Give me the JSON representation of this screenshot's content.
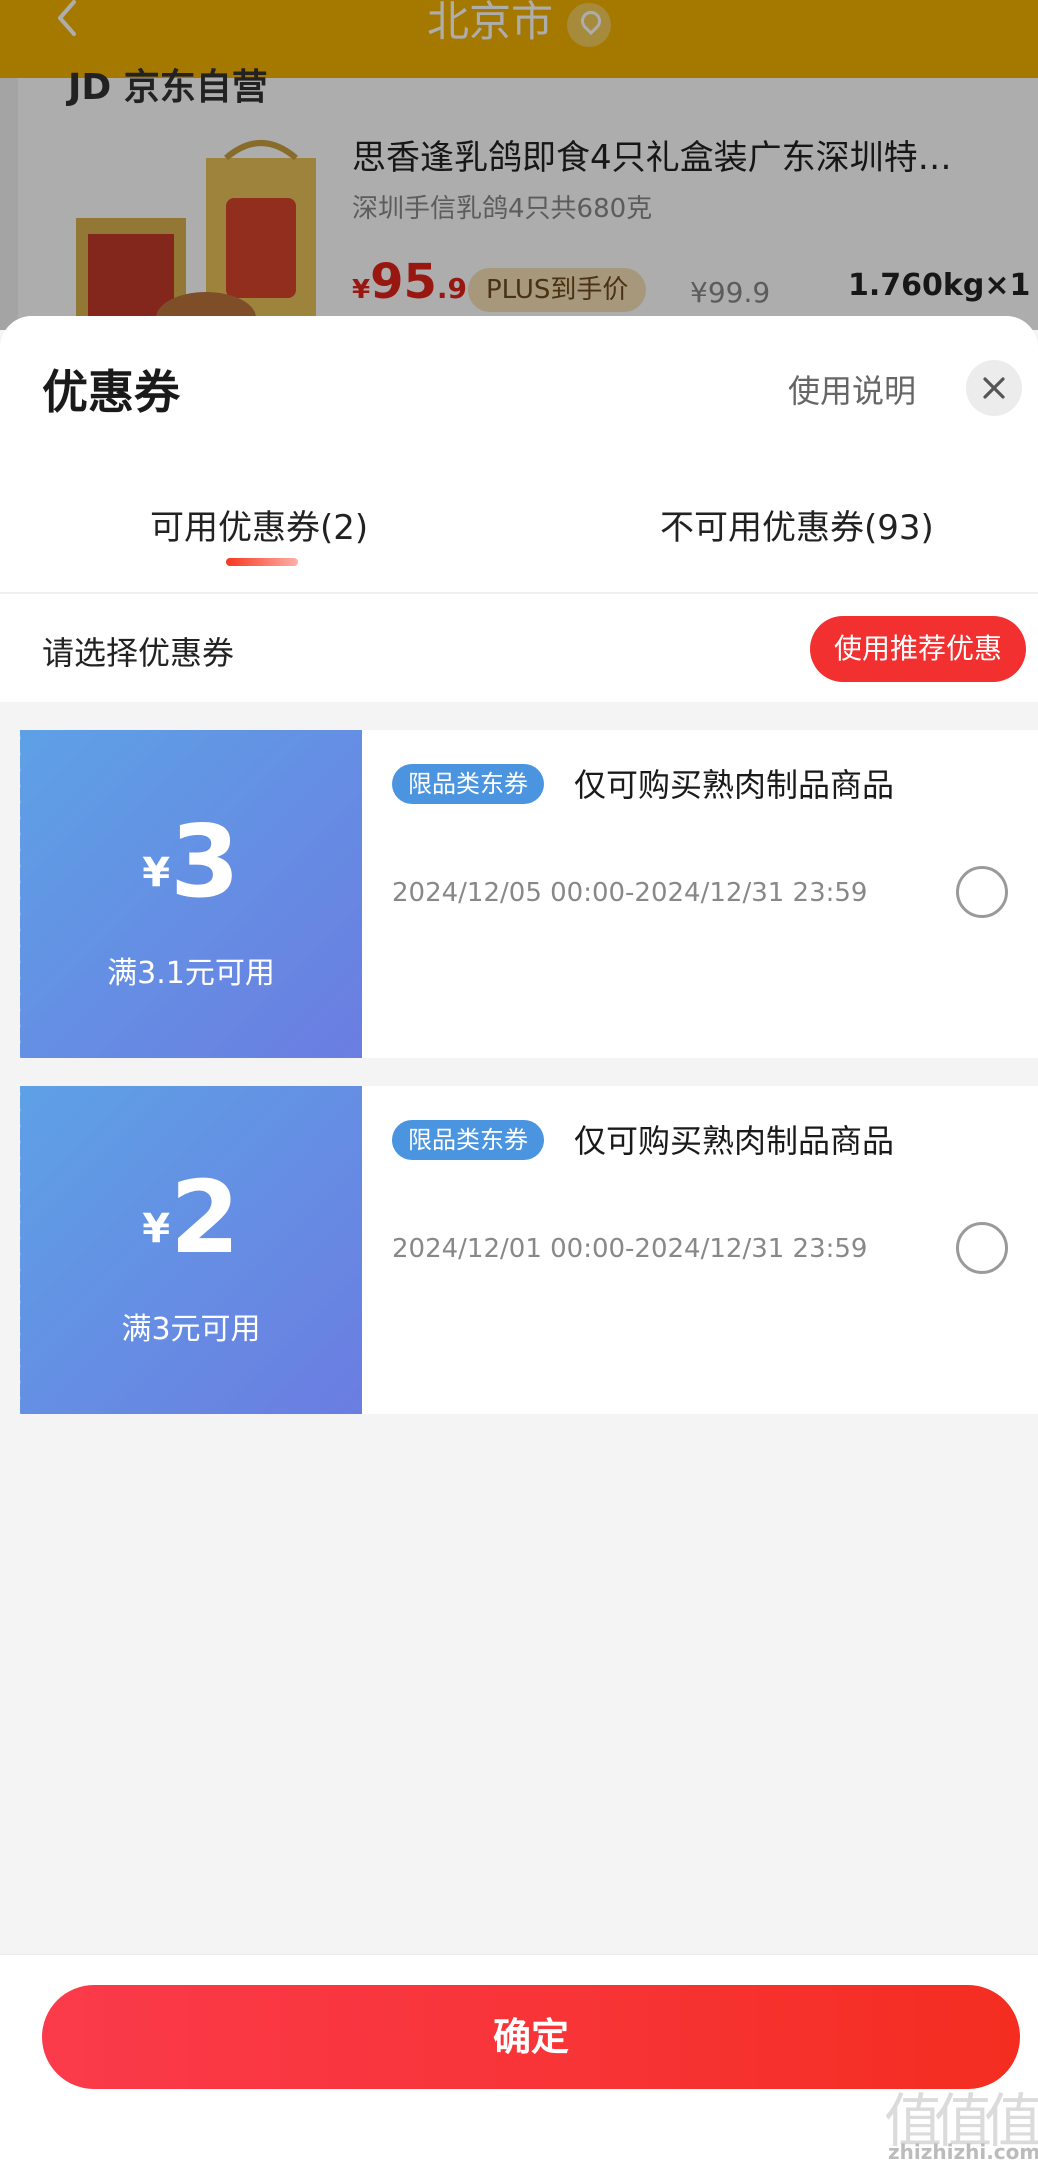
{
  "background": {
    "city": "北京市",
    "store": "JD 京东自营",
    "product": {
      "title": "思香逢乳鸽即食4只礼盒装广东深圳特…",
      "subtitle": "深圳手信乳鸽4只共680克",
      "price_currency": "¥",
      "price_int": "95",
      "price_dec": ".9",
      "plus_badge": "PLUS到手价",
      "original_price": "¥99.9",
      "weight_qty": "1.760kg×1"
    }
  },
  "sheet": {
    "title": "优惠券",
    "help_link": "使用说明",
    "tabs": [
      {
        "label": "可用优惠券(2)",
        "active": true
      },
      {
        "label": "不可用优惠券(93)",
        "active": false
      }
    ],
    "select_label": "请选择优惠券",
    "recommend_button": "使用推荐优惠"
  },
  "coupons": [
    {
      "currency": "¥",
      "amount": "3",
      "condition": "满3.1元可用",
      "tag": "限品类东券",
      "description": "仅可购买熟肉制品商品",
      "period": "2024/12/05 00:00-2024/12/31 23:59",
      "selected": false
    },
    {
      "currency": "¥",
      "amount": "2",
      "condition": "满3元可用",
      "tag": "限品类东券",
      "description": "仅可购买熟肉制品商品",
      "period": "2024/12/01 00:00-2024/12/31 23:59",
      "selected": false
    }
  ],
  "footer": {
    "confirm_button": "确定"
  },
  "watermark": {
    "text": "zhizhizhi.com"
  },
  "colors": {
    "accent_red": "#f23030",
    "coupon_blue_start": "#5ea1e6",
    "coupon_blue_end": "#6b7de1",
    "topbar_yellow": "#f3b200"
  }
}
